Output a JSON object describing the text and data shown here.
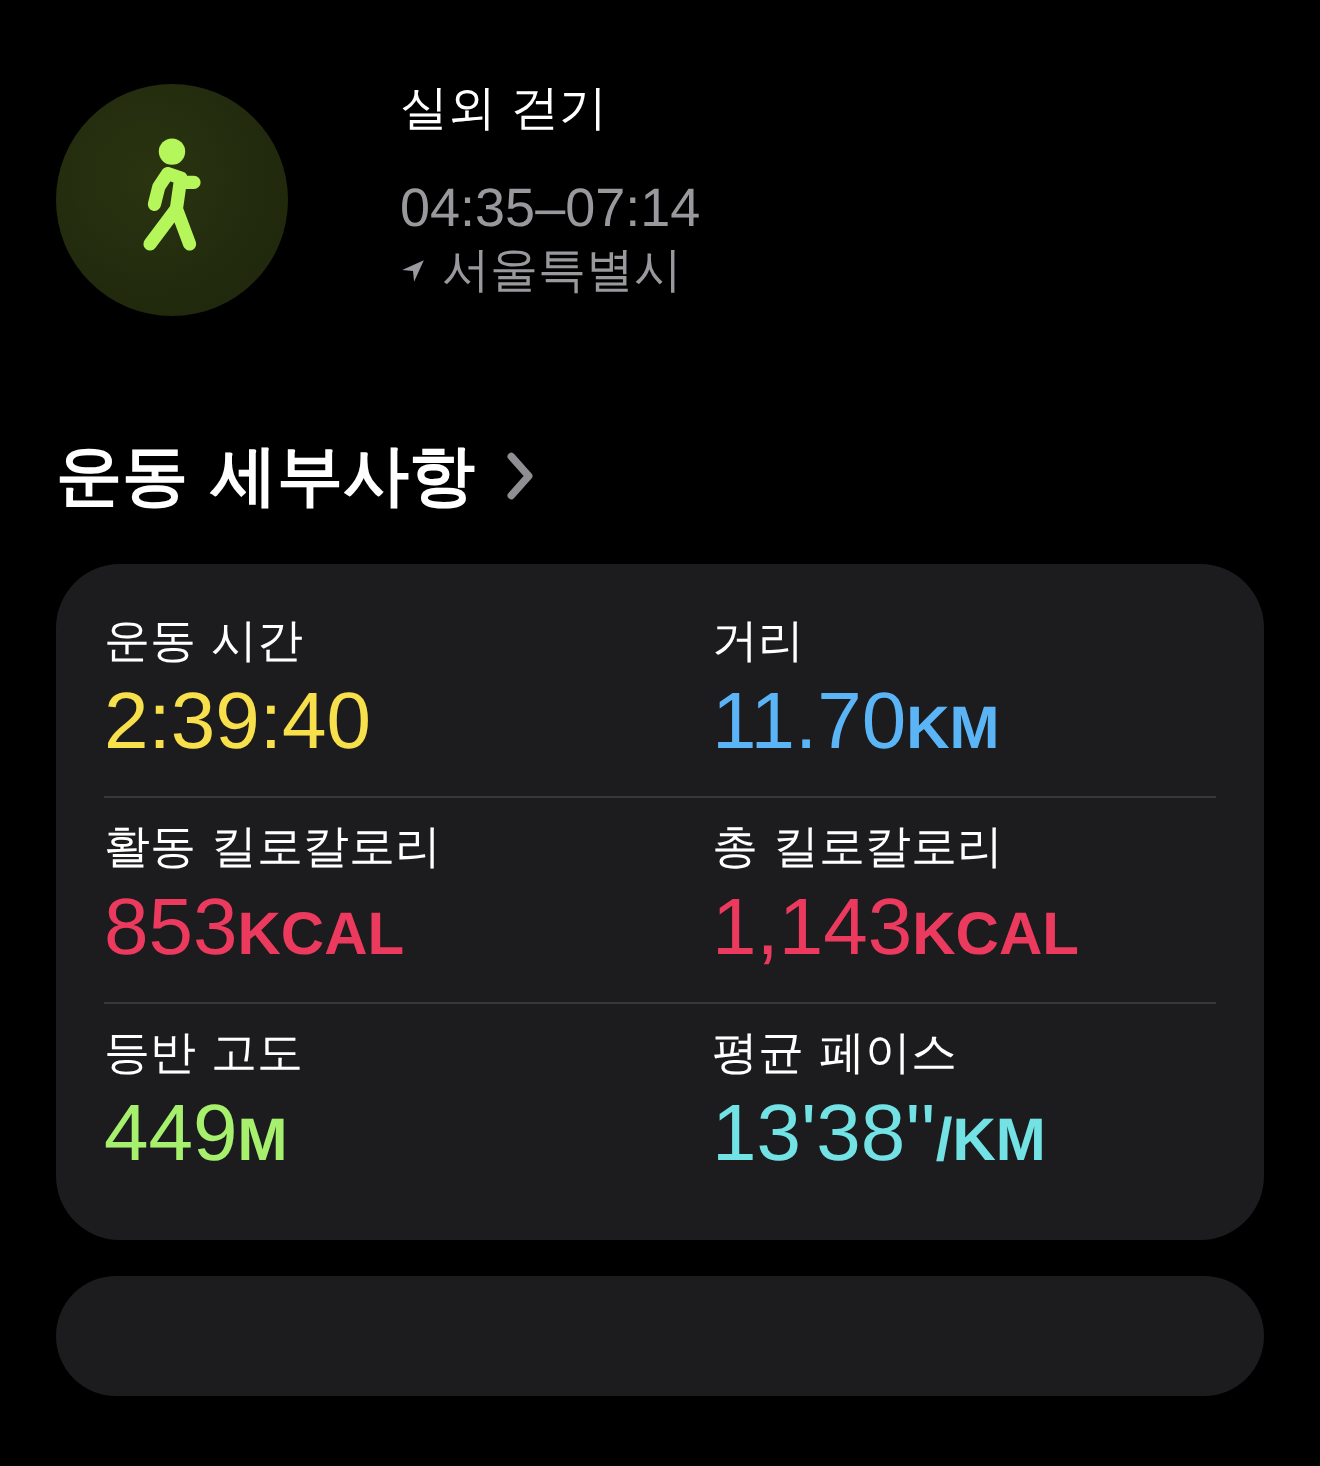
{
  "workout": {
    "title": "실외 걷기",
    "time": "04:35–07:14",
    "location": "서울특별시"
  },
  "section": {
    "title": "운동 세부사항"
  },
  "metrics": [
    {
      "label": "운동 시간",
      "value": "2:39:40",
      "color": "#f7e04b"
    },
    {
      "label": "거리",
      "value": "11.70",
      "unit": "KM",
      "color": "#5ab4f5"
    },
    {
      "label": "활동 킬로칼로리",
      "value": "853",
      "unit": "KCAL",
      "color": "#eb3a5e"
    },
    {
      "label": "총 킬로칼로리",
      "value": "1,143",
      "unit": "KCAL",
      "color": "#eb3a5e"
    },
    {
      "label": "등반 고도",
      "value": "449",
      "unit": "M",
      "color": "#a6f06e"
    },
    {
      "label": "평균 페이스",
      "value": "13'38''",
      "unit": "/KM",
      "color": "#72e2e4"
    }
  ]
}
